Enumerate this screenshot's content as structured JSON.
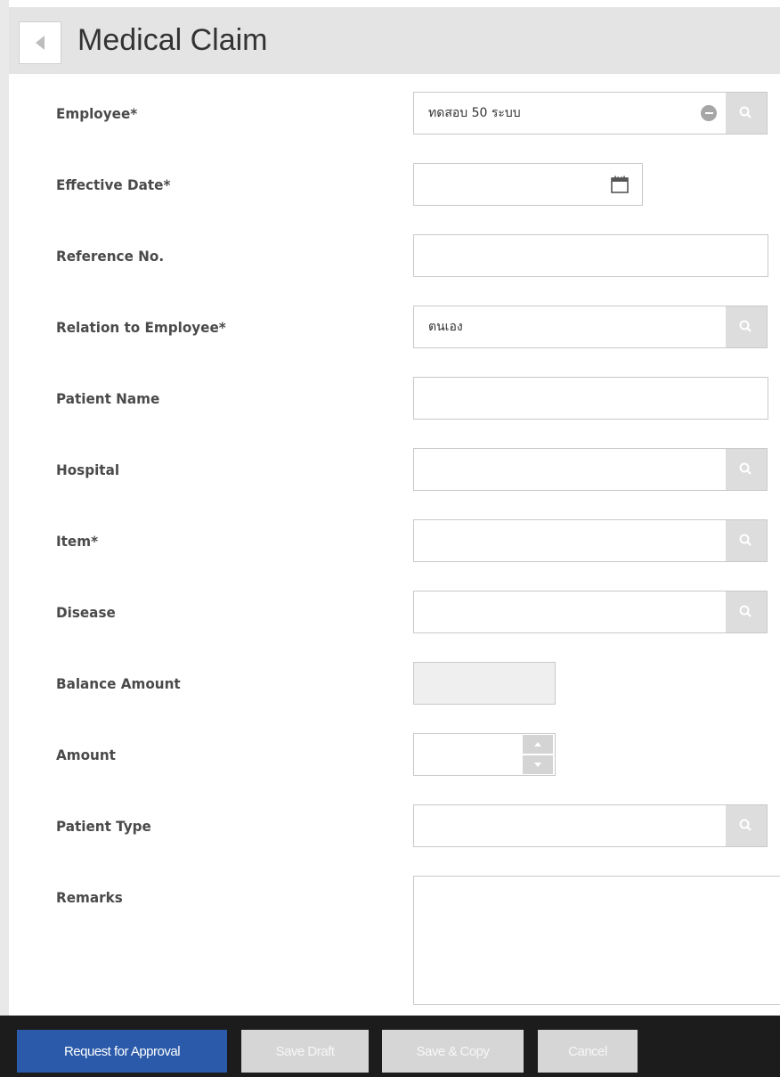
{
  "header": {
    "title": "Medical Claim"
  },
  "form": {
    "employee": {
      "label": "Employee*",
      "value": "ทดสอบ 50 ระบบ"
    },
    "effective_date": {
      "label": "Effective Date*",
      "value": ""
    },
    "reference_no": {
      "label": "Reference No.",
      "value": ""
    },
    "relation": {
      "label": "Relation to Employee*",
      "value": "ตนเอง"
    },
    "patient_name": {
      "label": "Patient Name",
      "value": ""
    },
    "hospital": {
      "label": "Hospital",
      "value": ""
    },
    "item": {
      "label": "Item*",
      "value": ""
    },
    "disease": {
      "label": "Disease",
      "value": ""
    },
    "balance_amount": {
      "label": "Balance Amount",
      "value": ""
    },
    "amount": {
      "label": "Amount",
      "value": ""
    },
    "patient_type": {
      "label": "Patient Type",
      "value": ""
    },
    "remarks": {
      "label": "Remarks",
      "value": ""
    }
  },
  "footer": {
    "request_label": "Request for Approval",
    "save_draft_label": "Save Draft",
    "save_copy_label": "Save & Copy",
    "cancel_label": "Cancel"
  },
  "icons": {
    "back": "chevron-left-icon",
    "lookup": "search-icon",
    "clear": "minus-circle-icon",
    "calendar": "calendar-icon"
  },
  "colors": {
    "primary": "#2a5aa9",
    "header_bg": "#e4e4e4",
    "footer_bg": "#1c1c1c",
    "secondary_btn": "#d6d6d6"
  }
}
